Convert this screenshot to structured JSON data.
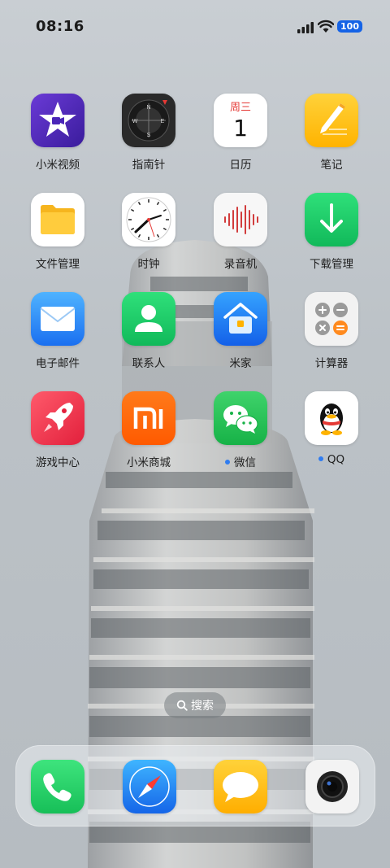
{
  "status_bar": {
    "time": "08:16",
    "battery": "100",
    "signal_icon": "cellular-signal-icon",
    "wifi_icon": "wifi-icon"
  },
  "apps": [
    {
      "label": "小米视频",
      "icon": "mi-video-icon",
      "dot": false
    },
    {
      "label": "指南针",
      "icon": "compass-icon",
      "dot": false
    },
    {
      "label": "日历",
      "icon": "calendar-icon",
      "dot": false,
      "weekday": "周三",
      "day": "1"
    },
    {
      "label": "笔记",
      "icon": "notes-icon",
      "dot": false
    },
    {
      "label": "文件管理",
      "icon": "file-manager-icon",
      "dot": false
    },
    {
      "label": "时钟",
      "icon": "clock-icon",
      "dot": false
    },
    {
      "label": "录音机",
      "icon": "recorder-icon",
      "dot": false
    },
    {
      "label": "下载管理",
      "icon": "downloads-icon",
      "dot": false
    },
    {
      "label": "电子邮件",
      "icon": "mail-icon",
      "dot": false
    },
    {
      "label": "联系人",
      "icon": "contacts-icon",
      "dot": false
    },
    {
      "label": "米家",
      "icon": "mi-home-icon",
      "dot": false
    },
    {
      "label": "计算器",
      "icon": "calculator-icon",
      "dot": false
    },
    {
      "label": "游戏中心",
      "icon": "game-center-icon",
      "dot": false
    },
    {
      "label": "小米商城",
      "icon": "mi-store-icon",
      "dot": false
    },
    {
      "label": "微信",
      "icon": "wechat-icon",
      "dot": true
    },
    {
      "label": "QQ",
      "icon": "qq-icon",
      "dot": true
    }
  ],
  "search": {
    "label": "搜索",
    "icon": "search-icon"
  },
  "dock": [
    {
      "name": "phone",
      "icon": "phone-icon"
    },
    {
      "name": "browser",
      "icon": "compass-browser-icon"
    },
    {
      "name": "messages",
      "icon": "messages-icon"
    },
    {
      "name": "camera",
      "icon": "camera-icon"
    }
  ],
  "colors": {
    "accent_blue": "#1563e6",
    "notification_dot": "#2f7cf0"
  }
}
